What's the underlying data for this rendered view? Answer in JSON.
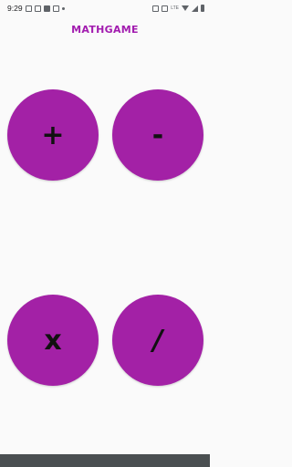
{
  "status_bar": {
    "time": "9:29",
    "network_label": "LTE"
  },
  "app": {
    "title": "MATHGAME"
  },
  "buttons": {
    "plus": "+",
    "minus": "-",
    "multiply": "x",
    "divide": "/"
  },
  "colors": {
    "accent": "#A21CAF",
    "button_fill": "#A321A6",
    "background": "#FAFAFA",
    "nav_bar": "#4A4F51"
  }
}
